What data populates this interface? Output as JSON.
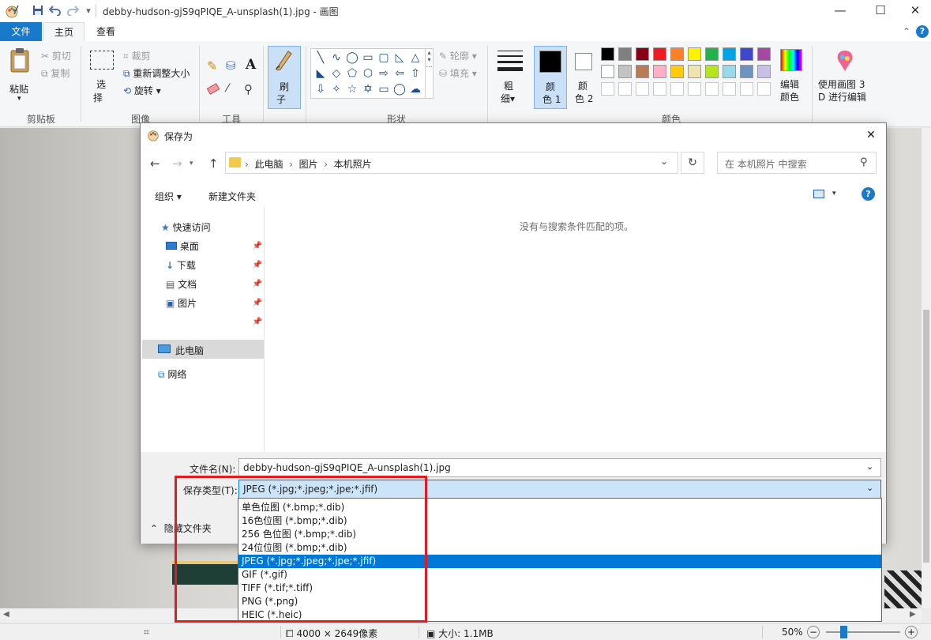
{
  "titlebar": {
    "title": "debby-hudson-gjS9qPIQE_A-unsplash(1).jpg - 画图",
    "dropdown": "▾",
    "min": "—",
    "max": "☐",
    "close": "✕"
  },
  "menu": {
    "file": "文件",
    "home": "主页",
    "view": "查看",
    "collapse": "⌃",
    "help": "?"
  },
  "ribbon": {
    "clipboard": {
      "paste": "粘贴",
      "cut": "剪切",
      "copy": "复制",
      "group": "剪贴板"
    },
    "image": {
      "select1": "选",
      "select2": "择",
      "crop": "裁剪",
      "resize": "重新调整大小",
      "rotate": "旋转",
      "group": "图像"
    },
    "tools": {
      "text": "A",
      "group": "工具"
    },
    "brush": {
      "label1": "刷",
      "label2": "子"
    },
    "shapes": {
      "outline": "轮廓",
      "fill": "填充",
      "group": "形状",
      "glyphs": [
        "╲",
        "∿",
        "◯",
        "▭",
        "▢",
        "◺",
        "△",
        "◣",
        "◇",
        "⬠",
        "⬡",
        "⇨",
        "⇦",
        "⇧",
        "⇩",
        "✧",
        "☆",
        "✡",
        "▭",
        "◯",
        "☁"
      ]
    },
    "size": {
      "label1": "粗",
      "label2": "细"
    },
    "color1": {
      "label1": "颜",
      "label2": "色 1"
    },
    "color2": {
      "label1": "颜",
      "label2": "色 2"
    },
    "colors_group": "颜色",
    "edit_colors": {
      "label1": "编辑",
      "label2": "颜色"
    },
    "paint3d": {
      "label1": "使用画图 3",
      "label2": "D 进行编辑"
    },
    "palette_row1": [
      "#000000",
      "#7f7f7f",
      "#880015",
      "#ed1c24",
      "#ff7f27",
      "#fff200",
      "#22b14c",
      "#00a2e8",
      "#3f48cc",
      "#a349a4"
    ],
    "palette_row2": [
      "#ffffff",
      "#c3c3c3",
      "#b97a57",
      "#ffaec9",
      "#ffc90e",
      "#efe4b0",
      "#b5e61d",
      "#99d9ea",
      "#7092be",
      "#c8bfe7"
    ]
  },
  "dialog": {
    "title": "保存为",
    "breadcrumb": [
      "此电脑",
      "图片",
      "本机照片"
    ],
    "search_placeholder": "在 本机照片 中搜索",
    "organize": "组织",
    "new_folder": "新建文件夹",
    "empty_message": "没有与搜索条件匹配的项。",
    "nav": {
      "quick_access": "快速访问",
      "desktop": "桌面",
      "downloads": "下载",
      "documents": "文档",
      "pictures": "图片",
      "this_pc": "此电脑",
      "network": "网络"
    },
    "filename_label": "文件名(N):",
    "filename_value": "debby-hudson-gjS9qPIQE_A-unsplash(1).jpg",
    "filetype_label": "保存类型(T):",
    "filetype_value": "JPEG (*.jpg;*.jpeg;*.jpe;*.jfif)",
    "hide_folders": "隐藏文件夹",
    "filetype_options": [
      "单色位图 (*.bmp;*.dib)",
      "16色位图 (*.bmp;*.dib)",
      "256 色位图 (*.bmp;*.dib)",
      "24位位图 (*.bmp;*.dib)",
      "JPEG (*.jpg;*.jpeg;*.jpe;*.jfif)",
      "GIF (*.gif)",
      "TIFF (*.tif;*.tiff)",
      "PNG (*.png)",
      "HEIC (*.heic)"
    ],
    "selected_index": 4
  },
  "status": {
    "dimensions": "4000 × 2649像素",
    "size": "大小: 1.1MB",
    "zoom": "50%",
    "zoom_out": "−",
    "zoom_in": "+"
  },
  "colors": {
    "accent": "#0078d7",
    "highlight_box": "#e01b24",
    "selected_nav": "#d9d9d9"
  }
}
